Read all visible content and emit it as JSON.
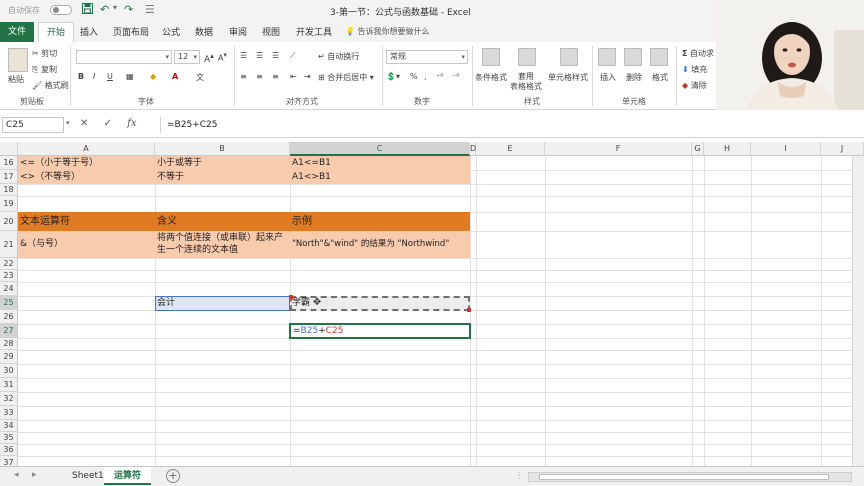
{
  "titlebar": {
    "autosave_label": "自动保存",
    "title": "3-第一节：公式与函数基础 - Excel"
  },
  "tabs": [
    "文件",
    "开始",
    "插入",
    "页面布局",
    "公式",
    "数据",
    "审阅",
    "视图",
    "开发工具"
  ],
  "active_tab": "开始",
  "tell_me": "告诉我你想要做什么",
  "ribbon": {
    "clipboard": {
      "paste": "粘贴",
      "cut": "剪切",
      "copy": "复制",
      "format_painter": "格式刷",
      "label": "剪贴板"
    },
    "font": {
      "size": "12",
      "bold": "B",
      "italic": "I",
      "underline": "U",
      "label": "字体"
    },
    "alignment": {
      "wrap": "自动换行",
      "merge": "合并后居中",
      "label": "对齐方式"
    },
    "number": {
      "format": "常规",
      "percent": "%",
      "comma": ",",
      "label": "数字"
    },
    "styles": {
      "conditional": "条件格式",
      "table": "套用\n表格格式",
      "cell": "单元格样式",
      "label": "样式"
    },
    "cells": {
      "insert": "插入",
      "delete": "删除",
      "format": "格式",
      "label": "单元格"
    },
    "editing": {
      "autosum": "自动求",
      "fill": "填充",
      "clear": "清除"
    }
  },
  "formula_bar": {
    "name_box": "C25",
    "cancel": "✕",
    "enter": "✓",
    "fx": "fx",
    "formula": "=B25+C25"
  },
  "columns": [
    "A",
    "B",
    "C",
    "D",
    "E",
    "F",
    "G",
    "H",
    "I",
    "J"
  ],
  "rows": {
    "r16": {
      "num": "16",
      "a": "<=（小于等于号）",
      "b": "小于或等于",
      "c": "A1<=B1"
    },
    "r17": {
      "num": "17",
      "a": "<>（不等号）",
      "b": "不等于",
      "c": "A1<>B1"
    },
    "r18": {
      "num": "18"
    },
    "r19": {
      "num": "19"
    },
    "r20": {
      "num": "20",
      "a": "文本运算符",
      "b": "含义",
      "c": "示例"
    },
    "r21": {
      "num": "21",
      "a": "&（与号）",
      "b": "将两个值连接（或串联）起来产生一个连续的文本值",
      "c": "\"North\"&\"wind\" 的结果为 \"Northwind\""
    },
    "r22": {
      "num": "22"
    },
    "r23": {
      "num": "23"
    },
    "r24": {
      "num": "24"
    },
    "r25": {
      "num": "25",
      "b": "会计",
      "c": "学霸"
    },
    "r26": {
      "num": "26"
    },
    "r27": {
      "num": "27",
      "c_eq": "=",
      "c_ref1": "B25",
      "c_plus": "+",
      "c_ref2": "C25"
    },
    "r28": {
      "num": "28"
    },
    "r29": {
      "num": "29"
    },
    "r30": {
      "num": "30"
    },
    "r31": {
      "num": "31"
    },
    "r32": {
      "num": "32"
    },
    "r33": {
      "num": "33"
    },
    "r34": {
      "num": "34"
    },
    "r35": {
      "num": "35"
    },
    "r36": {
      "num": "36"
    },
    "r37": {
      "num": "37"
    }
  },
  "sheets": [
    "Sheet1",
    "运算符"
  ],
  "active_sheet": "运算符",
  "colors": {
    "excel_green": "#217346",
    "peach": "#f8cbad",
    "orange": "#e07b23",
    "ref_blue": "#4472c4",
    "ref_red": "#c0392b"
  }
}
